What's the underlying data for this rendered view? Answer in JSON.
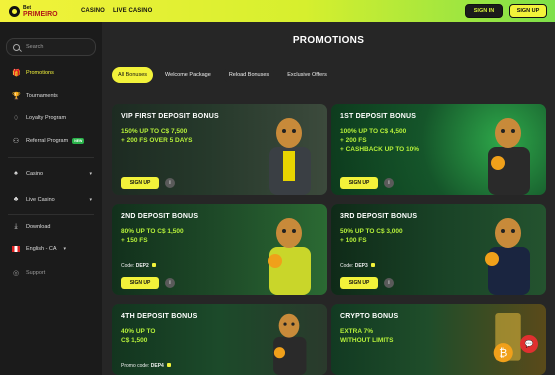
{
  "header": {
    "logo_top": "Bet",
    "logo_bottom": "PRIMEIRO",
    "nav": [
      "CASINO",
      "LIVE CASINO"
    ],
    "sign_in": "SIGN IN",
    "sign_up": "SIGN UP"
  },
  "sidebar": {
    "search_placeholder": "Search",
    "items": [
      {
        "label": "Promotions",
        "icon": "gift-icon"
      },
      {
        "label": "Tournaments",
        "icon": "trophy-icon"
      },
      {
        "label": "Loyalty Program",
        "icon": "loyalty-icon"
      },
      {
        "label": "Referral Program",
        "icon": "referral-icon",
        "badge": "NEW"
      },
      {
        "label": "Casino",
        "icon": "casino-icon"
      },
      {
        "label": "Live Casino",
        "icon": "live-casino-icon"
      },
      {
        "label": "Download",
        "icon": "download-icon"
      },
      {
        "label": "English - CA",
        "icon": "canada-flag-icon"
      },
      {
        "label": "Support",
        "icon": "support-icon"
      }
    ]
  },
  "main": {
    "title": "PROMOTIONS",
    "tabs": [
      "All Bonuses",
      "Welcome Package",
      "Reload Bonuses",
      "Exclusive Offers"
    ],
    "cards": [
      {
        "title": "VIP FIRST DEPOSIT BONUS",
        "offer": [
          "150% UP TO C$ 7,500",
          "+ 200 FS OVER 5 DAYS"
        ],
        "promo_label": "",
        "promo_code": "",
        "button": "SIGN UP"
      },
      {
        "title": "1ST DEPOSIT BONUS",
        "offer": [
          "100% UP TO C$ 4,500",
          "+ 200 FS",
          "+ CASHBACK UP TO 10%"
        ],
        "promo_label": "",
        "promo_code": "",
        "button": "SIGN UP"
      },
      {
        "title": "2ND DEPOSIT BONUS",
        "offer": [
          "80% UP TO C$ 1,500",
          "+ 150 FS"
        ],
        "promo_label": "Code:",
        "promo_code": "DEP2",
        "button": "SIGN UP"
      },
      {
        "title": "3RD DEPOSIT BONUS",
        "offer": [
          "50% UP TO C$ 3,000",
          "+ 100 FS"
        ],
        "promo_label": "Code:",
        "promo_code": "DEP3",
        "button": "SIGN UP"
      },
      {
        "title": "4TH DEPOSIT BONUS",
        "offer": [
          "40% UP TO",
          "C$ 1,500"
        ],
        "promo_label": "Promo code:",
        "promo_code": "DEP4",
        "button": ""
      },
      {
        "title": "CRYPTO BONUS",
        "offer": [
          "EXTRA 7%",
          "WITHOUT LIMITS"
        ],
        "promo_label": "",
        "promo_code": "",
        "button": ""
      }
    ]
  },
  "colors": {
    "accent": "#f2f23a",
    "offer_text": "#b7f23a",
    "chat": "#e03030"
  }
}
